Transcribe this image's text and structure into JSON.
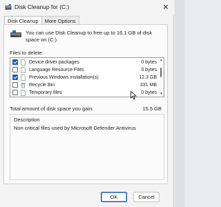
{
  "window": {
    "title": "Disk Cleanup for  (C:)",
    "icons": {
      "app": "disk-cleanup-icon",
      "close": "close-icon"
    }
  },
  "tabs": [
    {
      "label": "Disk Cleanup",
      "active": true
    },
    {
      "label": "More Options",
      "active": false
    }
  ],
  "intro": {
    "text": "You can use Disk Cleanup to free up to 16.1 GB of disk space on  (C:).",
    "icon": "hard-drive-icon"
  },
  "files": {
    "label": "Files to delete:",
    "items": [
      {
        "name": "Device driver packages",
        "size": "0 bytes",
        "checked": true,
        "icon": "blank-file-icon"
      },
      {
        "name": "Language Resource Files",
        "size": "0 bytes",
        "checked": false,
        "icon": "blank-file-icon"
      },
      {
        "name": "Previous Windows installation(s)",
        "size": "12.3 GB",
        "checked": true,
        "icon": "blank-file-icon"
      },
      {
        "name": "Recycle Bin",
        "size": "331 MB",
        "checked": false,
        "icon": "recycle-bin-icon"
      },
      {
        "name": "Temporary files",
        "size": "0 bytes",
        "checked": false,
        "icon": "blank-file-icon"
      }
    ]
  },
  "total": {
    "label": "Total amount of disk space you gain:",
    "value": "15.5 GB"
  },
  "description": {
    "title": "Description",
    "text": "Non critical files used by Microsoft Defender Antivirus"
  },
  "buttons": {
    "ok": "OK",
    "cancel": "Cancel"
  },
  "colors": {
    "accent": "#1a5fb4",
    "window_bg": "#f3f3f3",
    "panel_bg": "#fbfbfb"
  }
}
